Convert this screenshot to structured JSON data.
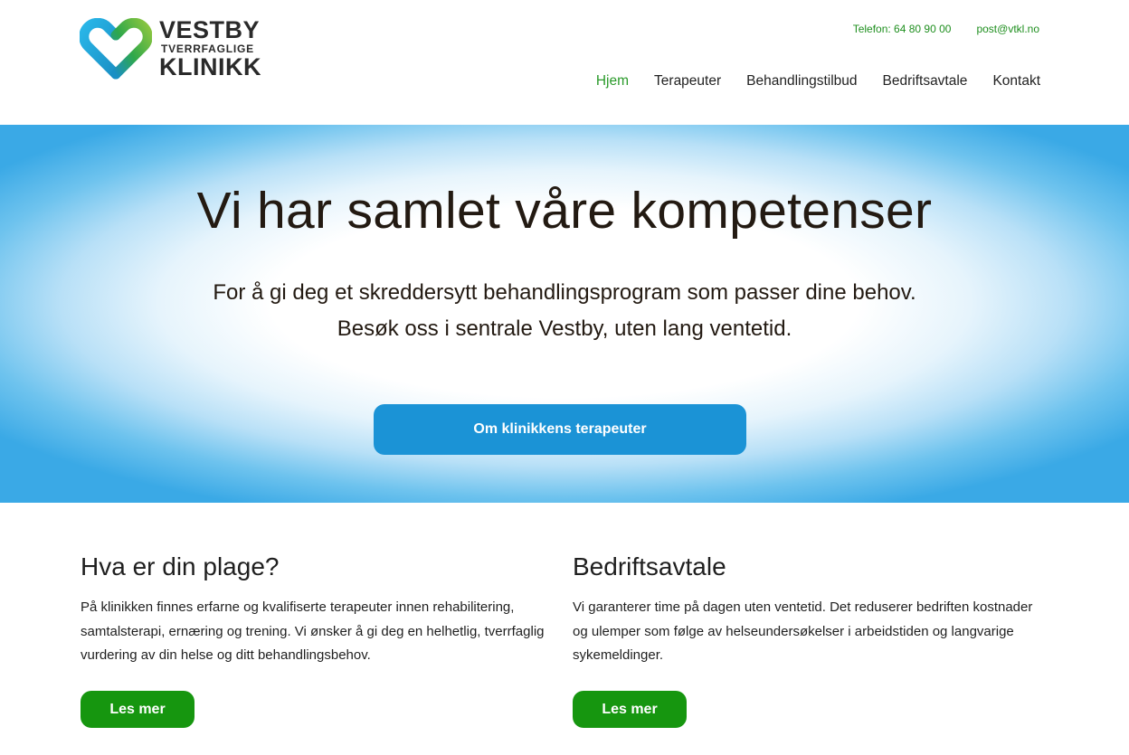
{
  "header": {
    "logo": {
      "line1": "VESTBY",
      "line2": "TVERRFAGLIGE",
      "line3": "KLINIKK",
      "icon": "heart-logo-icon"
    },
    "contact": {
      "phone": "Telefon: 64 80 90 00",
      "email": "post@vtkl.no"
    },
    "nav": [
      {
        "label": "Hjem",
        "active": true
      },
      {
        "label": "Terapeuter",
        "active": false
      },
      {
        "label": "Behandlingstilbud",
        "active": false
      },
      {
        "label": "Bedriftsavtale",
        "active": false
      },
      {
        "label": "Kontakt",
        "active": false
      }
    ]
  },
  "hero": {
    "title": "Vi har samlet våre kompetenser",
    "subtitle_line1": "For å gi deg et skreddersytt behandlingsprogram som passer dine behov.",
    "subtitle_line2": "Besøk oss i sentrale Vestby, uten lang ventetid.",
    "button": "Om klinikkens terapeuter"
  },
  "sections": [
    {
      "heading": "Hva er din plage?",
      "text": "På klinikken finnes erfarne og kvalifiserte terapeuter innen rehabilitering, samtalsterapi, ernæring og trening. Vi ønsker å gi deg en helhetlig, tverrfaglig vurdering av din helse og ditt behandlingsbehov.",
      "button": "Les mer"
    },
    {
      "heading": "Bedriftsavtale",
      "text": "Vi garanterer time på dagen uten ventetid. Det reduserer bedriften kostnader og ulemper som følge av helseundersøkelser i arbeidstiden og langvarige sykemeldinger.",
      "button": "Les mer"
    }
  ],
  "colors": {
    "accent_green": "#16960f",
    "accent_blue": "#1b93d6",
    "nav_active": "#2a9a2a"
  }
}
